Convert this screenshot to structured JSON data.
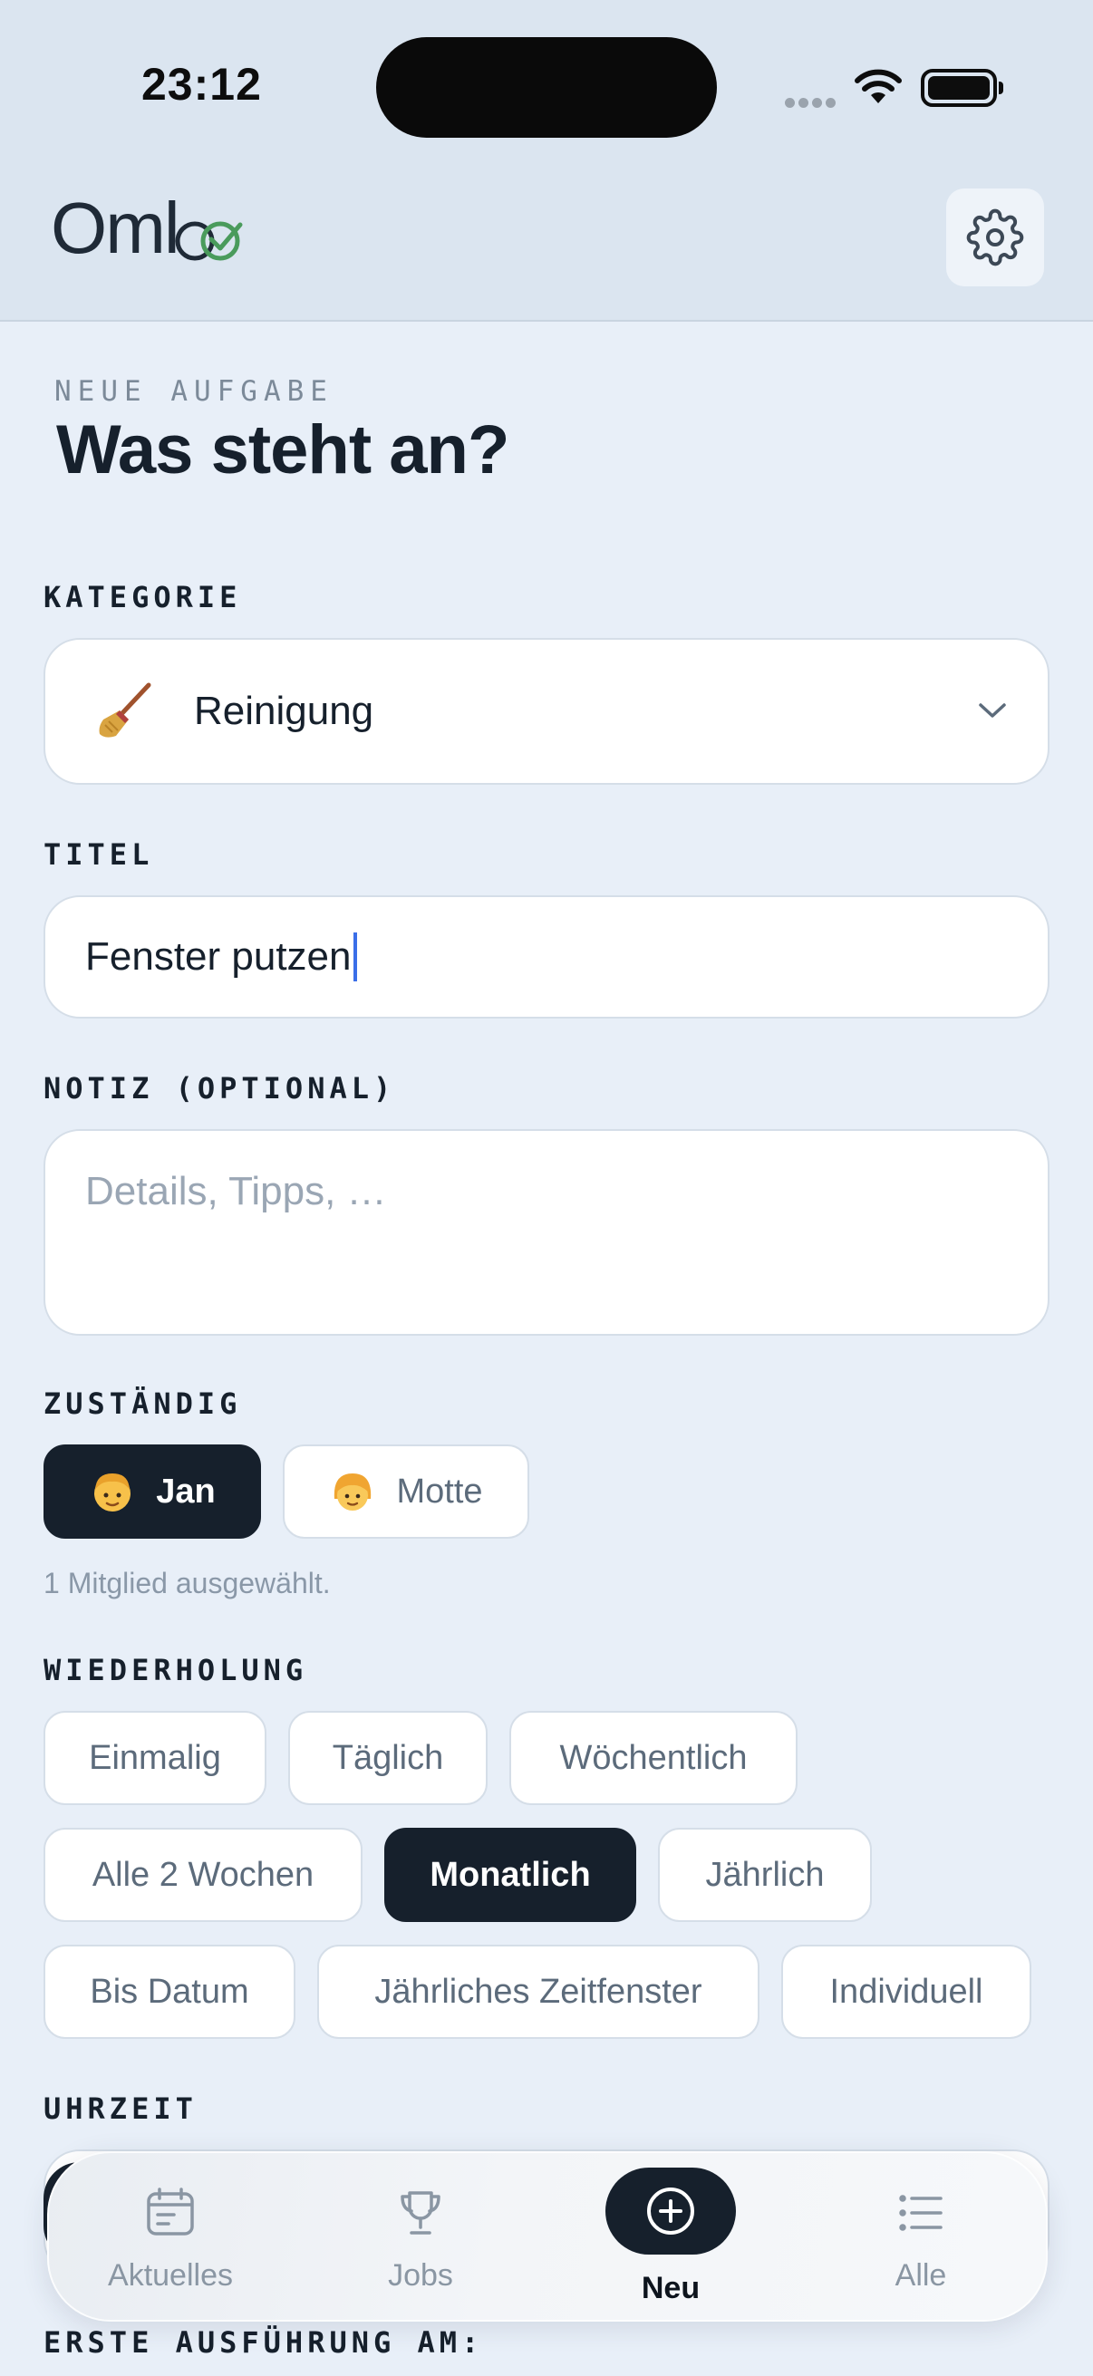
{
  "status_bar": {
    "time": "23:12"
  },
  "header": {
    "logo_text": "Oml",
    "settings_icon": "gear-icon"
  },
  "page": {
    "kicker": "NEUE AUFGABE",
    "title": "Was steht an?"
  },
  "category": {
    "label": "KATEGORIE",
    "icon": "broom-icon",
    "value": "Reinigung"
  },
  "title_field": {
    "label": "TITEL",
    "value": "Fenster putzen"
  },
  "note_field": {
    "label": "NOTIZ (OPTIONAL)",
    "placeholder": "Details, Tipps, …"
  },
  "assignees": {
    "label": "ZUSTÄNDIG",
    "members": [
      {
        "name": "Jan",
        "avatar": "boy-emoji",
        "selected": true
      },
      {
        "name": "Motte",
        "avatar": "girl-emoji",
        "selected": false
      }
    ],
    "hint": "1 Mitglied ausgewählt."
  },
  "repeat": {
    "label": "WIEDERHOLUNG",
    "options": [
      "Einmalig",
      "Täglich",
      "Wöchentlich",
      "Alle 2 Wochen",
      "Monatlich",
      "Jährlich",
      "Bis Datum",
      "Jährliches Zeitfenster",
      "Individuell"
    ],
    "selected": "Monatlich"
  },
  "time": {
    "label": "UHRZEIT"
  },
  "first_run": {
    "label": "ERSTE AUSFÜHRUNG AM:"
  },
  "tabbar": {
    "tabs": [
      {
        "label": "Aktuelles",
        "icon": "calendar-icon",
        "active": false
      },
      {
        "label": "Jobs",
        "icon": "trophy-icon",
        "active": false
      },
      {
        "label": "Neu",
        "icon": "plus-circle-icon",
        "active": true
      },
      {
        "label": "Alle",
        "icon": "list-icon",
        "active": false
      }
    ]
  },
  "colors": {
    "background": "#e8eff8",
    "header": "#dbe5f0",
    "dark": "#16202c",
    "logo_green": "#4a9b5c",
    "caret": "#3a6ee8"
  }
}
